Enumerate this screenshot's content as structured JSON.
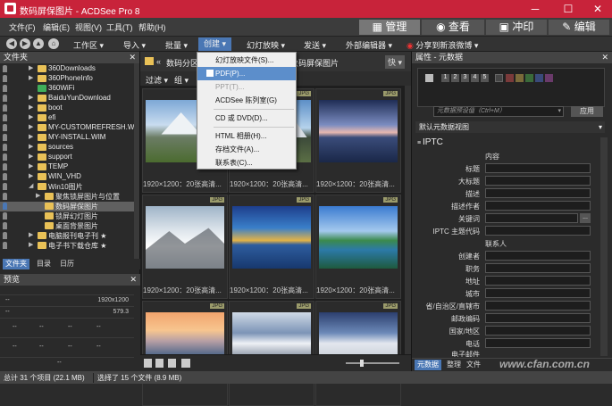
{
  "window": {
    "title": "数码屏保图片 - ACDSee Pro 8"
  },
  "menubar": {
    "items": [
      "文件(F)",
      "编辑(E)",
      "视图(V)",
      "工具(T)",
      "帮助(H)"
    ],
    "modes": [
      "管理",
      "查看",
      "冲印",
      "编辑"
    ]
  },
  "toolbar": {
    "items": [
      "工作区",
      "导入",
      "批量",
      "创建",
      "幻灯放映",
      "发送",
      "外部编辑器",
      "分享到新浪微博"
    ]
  },
  "create_menu": [
    "幻灯放映文件(S)...",
    "PDF(P)...",
    "PPT(T)...",
    "ACDSee 陈列室(G)",
    "CD 或 DVD(D)...",
    "HTML 相册(H)...",
    "存档文件(A)...",
    "联系表(C)..."
  ],
  "left": {
    "panel_title": "文件夹",
    "tree": [
      "360Downloads",
      "360PhoneInfo",
      "360WiFi",
      "BaiduYunDownload",
      "boot",
      "efi",
      "MY-CUSTOMREFRESH.W",
      "MY-INSTALL.WIM",
      "sources",
      "support",
      "TEMP",
      "WIN_VHD",
      "Win10图片",
      "聚焦锁屏图片与位置",
      "数码屏保图片",
      "锁屏幻灯图片",
      "桌面背景图片",
      "电脑报刊电子刊 ★",
      "电子书下载仓库 ★"
    ],
    "tabs": [
      "文件夹",
      "目录",
      "日历"
    ],
    "preview_title": "预览",
    "preview_vals": [
      "1920x1200",
      "579.3"
    ],
    "dashes": "--"
  },
  "center": {
    "breadcrumb": "数码分区",
    "folder": "数码屏保图片",
    "filter": "过滤",
    "group": "组",
    "quick": "快",
    "badge": "JPG",
    "caption": "1920×1200：20张高清..."
  },
  "right": {
    "panel_title": "属性 - 元数据",
    "preset_placeholder": "元数据预设值（Ctrl+M）",
    "apply": "应用",
    "view_select": "默认元数据视图",
    "iptc": "IPTC",
    "content_group": "内容",
    "content_fields": [
      "标题",
      "大标题",
      "描述",
      "描述作者",
      "关键词",
      "IPTC 主题代码"
    ],
    "contact_group": "联系人",
    "contact_fields": [
      "创建者",
      "职务",
      "地址",
      "城市",
      "省/自治区/直辖市",
      "邮政编码",
      "国家/地区",
      "电话",
      "电子邮件"
    ],
    "tabs": [
      "元数据",
      "整理",
      "文件"
    ],
    "labels_nums": [
      "1",
      "2",
      "3",
      "4",
      "5"
    ]
  },
  "status": {
    "total": "总计 31 个项目 (22.1 MB)",
    "selected": "选择了 15 个文件 (8.9 MB)"
  },
  "watermark": "www.cfan.com.cn",
  "colors": {
    "title": "#c8233a",
    "accent": "#4a77b4",
    "folder": "#e9c157"
  }
}
